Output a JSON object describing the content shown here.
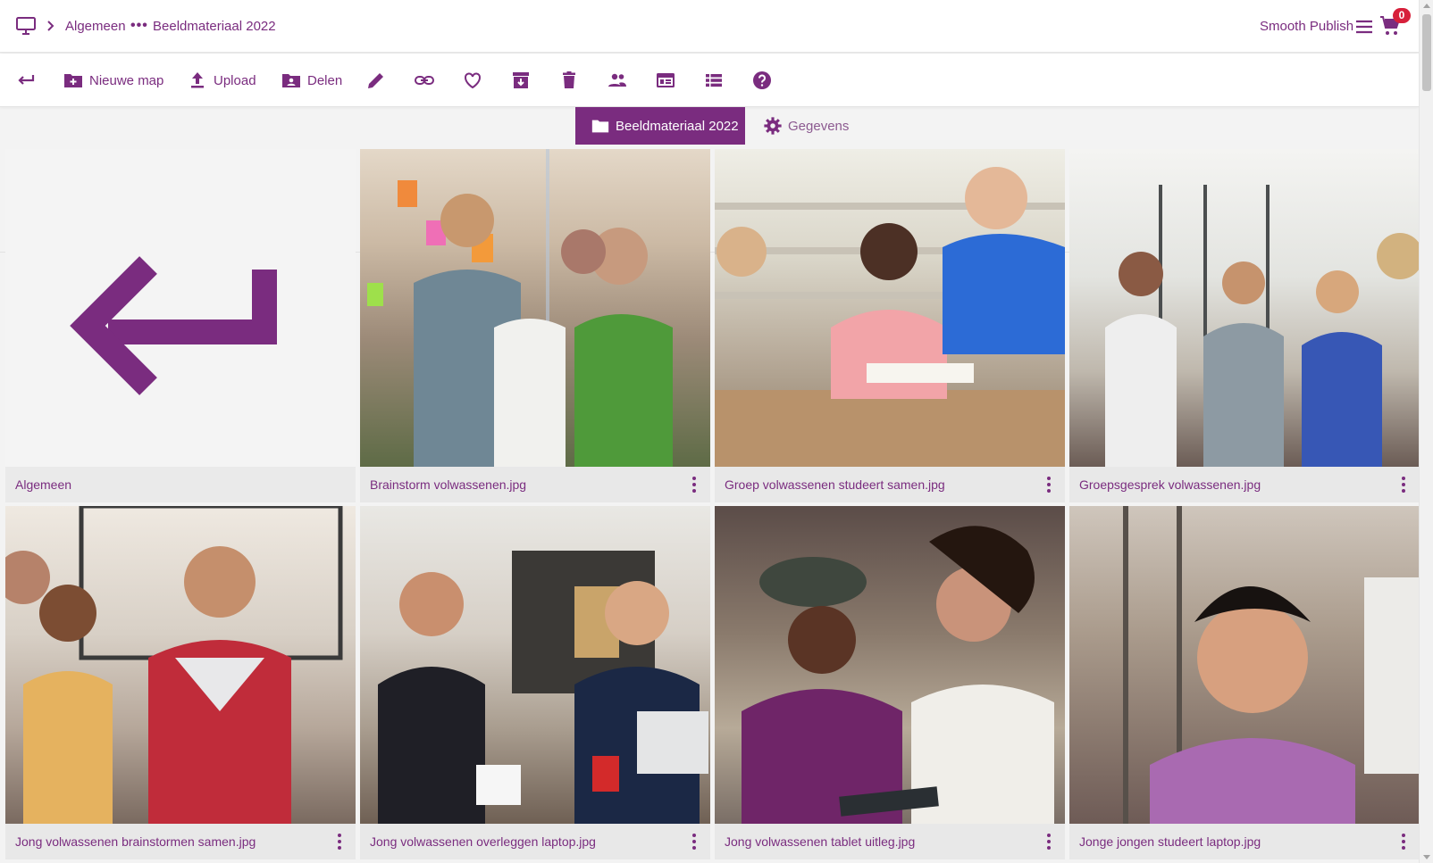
{
  "header": {
    "home_icon": "monitor-icon",
    "breadcrumb": [
      "Algemeen",
      "Beeldmateriaal 2022"
    ],
    "ellipsis": "•••",
    "brand": "Smooth Publish",
    "cart_count": "0"
  },
  "toolbar": {
    "items": [
      {
        "icon": "back-arrow-icon",
        "label": ""
      },
      {
        "icon": "new-folder-icon",
        "label": "Nieuwe map"
      },
      {
        "icon": "upload-icon",
        "label": "Upload"
      },
      {
        "icon": "share-folder-icon",
        "label": "Delen"
      },
      {
        "icon": "pencil-icon",
        "label": ""
      },
      {
        "icon": "link-icon",
        "label": ""
      },
      {
        "icon": "heart-icon",
        "label": ""
      },
      {
        "icon": "archive-icon",
        "label": ""
      },
      {
        "icon": "trash-icon",
        "label": ""
      },
      {
        "icon": "people-icon",
        "label": ""
      },
      {
        "icon": "tile-view-icon",
        "label": ""
      },
      {
        "icon": "list-view-icon",
        "label": ""
      },
      {
        "icon": "help-icon",
        "label": ""
      }
    ]
  },
  "tabs": [
    {
      "label": "Beeldmateriaal 2022",
      "icon": "folder-icon",
      "active": true
    },
    {
      "label": "Gegevens",
      "icon": "gear-icon",
      "active": false
    }
  ],
  "grid": {
    "items": [
      {
        "name": "Algemeen",
        "type": "parent-folder"
      },
      {
        "name": "Brainstorm volwassenen.jpg",
        "type": "image"
      },
      {
        "name": "Groep volwassenen studeert samen.jpg",
        "type": "image"
      },
      {
        "name": "Groepsgesprek volwassenen.jpg",
        "type": "image"
      },
      {
        "name": "Jong volwassenen brainstormen samen.jpg",
        "type": "image"
      },
      {
        "name": "Jong volwassenen overleggen laptop.jpg",
        "type": "image"
      },
      {
        "name": "Jong volwassenen tablet uitleg.jpg",
        "type": "image"
      },
      {
        "name": "Jonge jongen studeert laptop.jpg",
        "type": "image"
      }
    ]
  },
  "colors": {
    "accent": "#7a2c7f",
    "badge": "#d7203b",
    "caption_bg": "#e8e8e8"
  }
}
